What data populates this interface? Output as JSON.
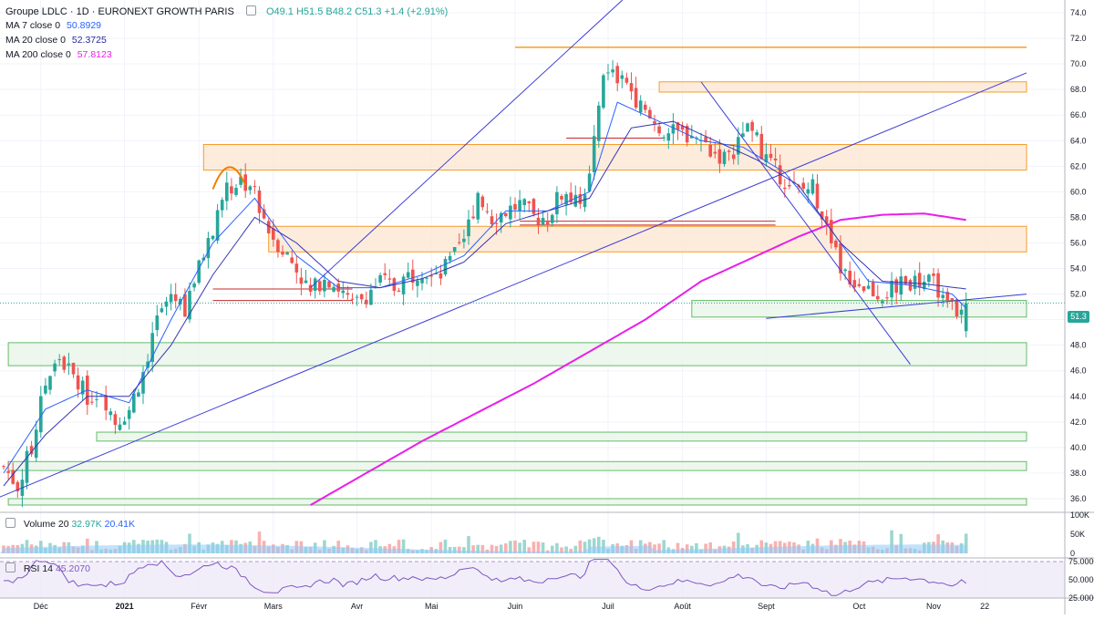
{
  "header": {
    "symbol": "Groupe LDLC · 1D · EURONEXT GROWTH PARIS",
    "ohlc": "O49.1  H51.5  B48.2  C51.3  +1.4 (+2.91%)"
  },
  "indicators": [
    {
      "label": "MA 7 close 0",
      "value": "50.8929",
      "color": "#2962ff"
    },
    {
      "label": "MA 20 close 0",
      "value": "52.3725",
      "color": "#2929a0"
    },
    {
      "label": "MA 200 close 0",
      "value": "57.8123",
      "color": "#e91ee9"
    }
  ],
  "volume_pane": {
    "label": "Volume 20",
    "v1": "32.97K",
    "v2": "20.41K",
    "ticks": [
      "100K",
      "50K",
      "0"
    ]
  },
  "rsi_pane": {
    "label": "RSI 14",
    "value": "45.2070",
    "ticks": [
      "75.0000",
      "50.0000",
      "25.0000"
    ]
  },
  "price_badge": "51.3",
  "colors": {
    "up": "#26a69a",
    "down": "#ef5350",
    "ma7": "#2962ff",
    "ma20": "#3535b5",
    "ma200": "#e91ee9",
    "trend": "#3b3bd6",
    "zone_fill": "#fde7d3",
    "zone_stroke": "#f59d2a",
    "support_fill": "#e8f5e9",
    "support_stroke": "#66bb6a"
  },
  "chart_data": {
    "type": "candlestick",
    "title": "Groupe LDLC · 1D · EURONEXT GROWTH PARIS",
    "x_ticks": [
      "Déc",
      "2021",
      "Févr",
      "Mars",
      "Avr",
      "Mai",
      "Juin",
      "Juil",
      "Août",
      "Sept",
      "Oct",
      "Nov",
      "22"
    ],
    "y_ticks": [
      36,
      38,
      40,
      42,
      44,
      46,
      48,
      50,
      52,
      54,
      56,
      58,
      60,
      62,
      64,
      66,
      68,
      70,
      72,
      74
    ],
    "ylim": [
      35,
      75
    ],
    "close_path": [
      [
        0,
        38.5
      ],
      [
        3,
        37
      ],
      [
        6,
        40
      ],
      [
        9,
        45
      ],
      [
        12,
        47
      ],
      [
        15,
        45.5
      ],
      [
        18,
        44
      ],
      [
        21,
        44.5
      ],
      [
        24,
        42
      ],
      [
        27,
        43
      ],
      [
        30,
        46
      ],
      [
        33,
        50
      ],
      [
        36,
        52
      ],
      [
        39,
        51
      ],
      [
        42,
        54
      ],
      [
        45,
        57
      ],
      [
        48,
        60
      ],
      [
        51,
        61
      ],
      [
        54,
        60
      ],
      [
        57,
        57
      ],
      [
        60,
        55.5
      ],
      [
        63,
        54
      ],
      [
        66,
        52
      ],
      [
        69,
        53.5
      ],
      [
        72,
        52.5
      ],
      [
        75,
        51
      ],
      [
        78,
        52
      ],
      [
        81,
        53
      ],
      [
        84,
        52.5
      ],
      [
        87,
        53.5
      ],
      [
        90,
        54
      ],
      [
        93,
        53
      ],
      [
        96,
        54.5
      ],
      [
        99,
        56
      ],
      [
        102,
        60
      ],
      [
        105,
        58
      ],
      [
        108,
        58.5
      ],
      [
        111,
        59
      ],
      [
        114,
        58
      ],
      [
        117,
        58
      ],
      [
        120,
        60
      ],
      [
        123,
        59
      ],
      [
        126,
        61
      ],
      [
        129,
        69
      ],
      [
        132,
        69
      ],
      [
        135,
        68
      ],
      [
        138,
        66
      ],
      [
        141,
        65
      ],
      [
        144,
        64.5
      ],
      [
        147,
        64.5
      ],
      [
        150,
        64
      ],
      [
        153,
        63
      ],
      [
        156,
        62.5
      ],
      [
        159,
        65
      ],
      [
        162,
        64
      ],
      [
        165,
        62
      ],
      [
        168,
        61
      ],
      [
        171,
        60
      ],
      [
        174,
        60.5
      ],
      [
        177,
        57
      ],
      [
        180,
        54
      ],
      [
        183,
        53
      ],
      [
        186,
        52.5
      ],
      [
        189,
        52
      ],
      [
        192,
        52.5
      ],
      [
        195,
        53
      ],
      [
        198,
        53
      ],
      [
        201,
        52.5
      ],
      [
        204,
        52
      ],
      [
        206,
        50
      ],
      [
        207,
        51.3
      ]
    ],
    "ma7": [
      [
        0,
        38
      ],
      [
        9,
        43
      ],
      [
        18,
        44.5
      ],
      [
        27,
        43.5
      ],
      [
        36,
        50
      ],
      [
        45,
        56
      ],
      [
        54,
        59.5
      ],
      [
        63,
        55
      ],
      [
        72,
        52.5
      ],
      [
        81,
        52.5
      ],
      [
        90,
        53.5
      ],
      [
        99,
        55
      ],
      [
        108,
        58.5
      ],
      [
        117,
        58.5
      ],
      [
        126,
        60
      ],
      [
        132,
        67
      ],
      [
        141,
        65.5
      ],
      [
        150,
        64
      ],
      [
        159,
        63.5
      ],
      [
        168,
        61.5
      ],
      [
        177,
        57.5
      ],
      [
        186,
        53
      ],
      [
        195,
        52.7
      ],
      [
        204,
        52
      ],
      [
        207,
        50.9
      ]
    ],
    "ma20": [
      [
        0,
        37
      ],
      [
        9,
        41
      ],
      [
        18,
        44
      ],
      [
        27,
        44
      ],
      [
        36,
        48
      ],
      [
        45,
        53.5
      ],
      [
        54,
        58
      ],
      [
        63,
        56
      ],
      [
        72,
        53
      ],
      [
        81,
        52.5
      ],
      [
        90,
        53.2
      ],
      [
        99,
        54.5
      ],
      [
        108,
        57.5
      ],
      [
        117,
        58.5
      ],
      [
        126,
        59.5
      ],
      [
        135,
        65
      ],
      [
        144,
        65.5
      ],
      [
        153,
        64
      ],
      [
        162,
        62.5
      ],
      [
        171,
        60.5
      ],
      [
        180,
        56
      ],
      [
        189,
        53
      ],
      [
        198,
        52.8
      ],
      [
        207,
        52.4
      ]
    ],
    "ma200": [
      [
        66,
        35.5
      ],
      [
        90,
        40.5
      ],
      [
        114,
        45
      ],
      [
        138,
        50
      ],
      [
        150,
        53
      ],
      [
        162,
        55
      ],
      [
        171,
        56.5
      ],
      [
        180,
        57.8
      ],
      [
        189,
        58.2
      ],
      [
        198,
        58.3
      ],
      [
        207,
        57.8
      ]
    ],
    "zones": [
      {
        "d0": 43,
        "d1": 220,
        "lo": 61.7,
        "hi": 63.7,
        "kind": "resist"
      },
      {
        "d0": 141,
        "d1": 220,
        "lo": 67.8,
        "hi": 68.6,
        "kind": "resist"
      },
      {
        "d0": 57,
        "d1": 220,
        "lo": 55.3,
        "hi": 57.3,
        "kind": "resist"
      },
      {
        "d0": 148,
        "d1": 220,
        "lo": 50.2,
        "hi": 51.5,
        "kind": "support"
      },
      {
        "d0": 1,
        "d1": 220,
        "lo": 46.4,
        "hi": 48.2,
        "kind": "support"
      },
      {
        "d0": 20,
        "d1": 220,
        "lo": 40.5,
        "hi": 41.2,
        "kind": "support"
      },
      {
        "d0": 1,
        "d1": 220,
        "lo": 38.2,
        "hi": 38.9,
        "kind": "support"
      },
      {
        "d0": 1,
        "d1": 220,
        "lo": 35.5,
        "hi": 36,
        "kind": "support"
      }
    ],
    "hlines": [
      {
        "d0": 110,
        "d1": 220,
        "y": 71.3
      },
      {
        "d0": 45,
        "d1": 75,
        "y": 52.4
      },
      {
        "d0": 45,
        "d1": 75,
        "y": 51.5
      },
      {
        "d0": 111,
        "d1": 166,
        "y": 57.7
      },
      {
        "d0": 111,
        "d1": 166,
        "y": 57.4
      },
      {
        "d0": 121,
        "d1": 142,
        "y": 64.2
      }
    ],
    "trendlines": [
      {
        "d0": 66,
        "y0": 52.5,
        "d1": 148,
        "y1": 80
      },
      {
        "d0": -3,
        "y0": 35.8,
        "d1": 220,
        "y1": 69.3
      },
      {
        "d0": 150,
        "y0": 68.6,
        "d1": 195,
        "y1": 46.5
      },
      {
        "d0": 164,
        "y0": 50.1,
        "d1": 220,
        "y1": 52
      }
    ],
    "volume": {
      "ylim": [
        0,
        100000
      ]
    },
    "rsi": {
      "ylim": [
        25,
        75
      ]
    }
  }
}
